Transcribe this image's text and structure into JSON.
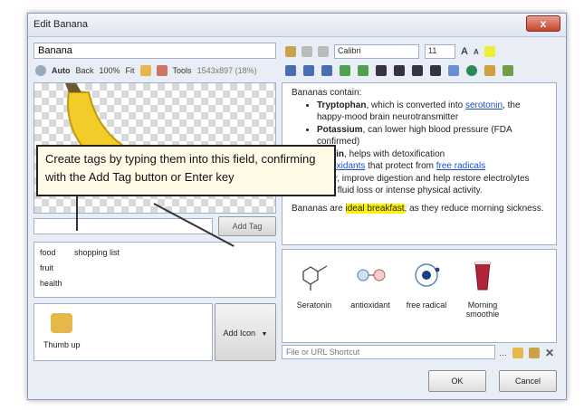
{
  "window": {
    "title": "Edit Banana",
    "close_label": "x"
  },
  "name_field": {
    "value": "Banana"
  },
  "image_toolbar": {
    "auto": "Auto",
    "back": "Back",
    "zoom": "100%",
    "fit": "Fit",
    "tools": "Tools",
    "dims": "1543x897 (18%)"
  },
  "format_toolbar": {
    "font": "Calibri",
    "size": "11"
  },
  "editor": {
    "intro": "Bananas contain:",
    "items": [
      {
        "bold": "Tryptophan",
        "text": ", which is converted into ",
        "link": "serotonin",
        "after": ", the happy-mood brain neurotransmitter"
      },
      {
        "bold": "Potassium",
        "text": ", can lower high blood pressure (FDA confirmed)",
        "link": "",
        "after": ""
      },
      {
        "bold": "Pectin",
        "text": ", helps with detoxification",
        "link": "",
        "after": ""
      },
      {
        "bold": "",
        "text": "",
        "link": "antioxidants",
        "after": " that protect from "
      },
      {
        "bold": "",
        "text": "Fiber, improve digestion and help restore electrolytes after fluid loss or intense physical activity.",
        "link": "",
        "after": ""
      }
    ],
    "link_free_radicals": "free radicals",
    "closing_pre": "Bananas are ",
    "closing_highlight": "ideal breakfast",
    "closing_post": ", as they reduce morning sickness."
  },
  "add_tag_label": "Add Tag",
  "tags": [
    "food",
    "shopping list",
    "fruit",
    "health"
  ],
  "icon_item": {
    "label": "Thumb up"
  },
  "add_icon_label": "Add Icon",
  "attachments": [
    {
      "label": "Seratonin",
      "icon": "molecule-icon"
    },
    {
      "label": "antioxidant",
      "icon": "antioxidant-icon"
    },
    {
      "label": "free radical",
      "icon": "free-radical-icon"
    },
    {
      "label": "Morning smoothie",
      "icon": "smoothie-icon"
    }
  ],
  "url_field": {
    "placeholder": "File or URL Shortcut"
  },
  "buttons": {
    "ok": "OK",
    "cancel": "Cancel"
  },
  "callout": {
    "text": "Create tags by typing them into this field, confirming with the Add Tag button or Enter key"
  },
  "colors": {
    "accent": "#1a4fd0",
    "highlight": "#fff200",
    "callout_bg": "#fffbe6"
  }
}
